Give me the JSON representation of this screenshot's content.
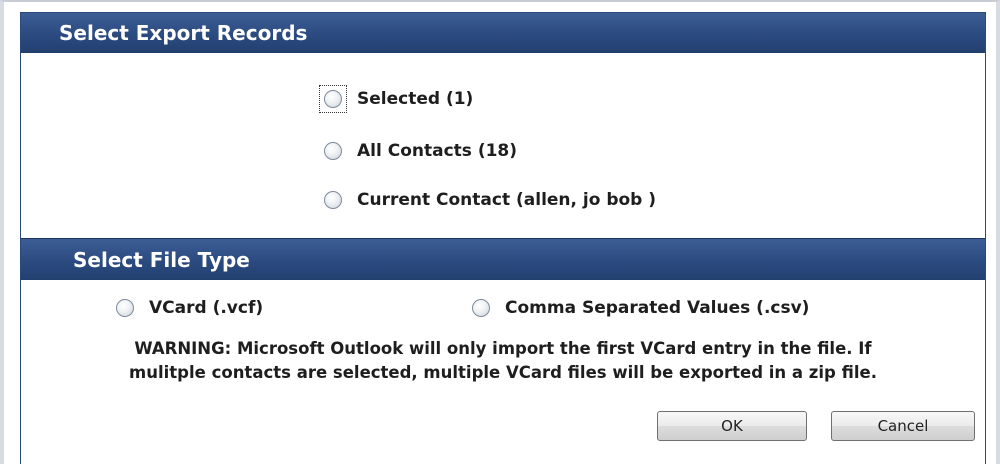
{
  "export_section": {
    "title": "Select Export Records",
    "options": [
      {
        "label": "Selected (1)",
        "checked": false,
        "focused": true
      },
      {
        "label": "All Contacts (18)",
        "checked": false
      },
      {
        "label": "Current Contact (allen, jo bob )",
        "checked": false
      }
    ]
  },
  "filetype_section": {
    "title": "Select File Type",
    "options": [
      {
        "label": "VCard (.vcf)",
        "checked": false
      },
      {
        "label": "Comma Separated Values (.csv)",
        "checked": false
      }
    ],
    "warning_line1": "WARNING: Microsoft Outlook will only import the first VCard entry in the file. If",
    "warning_line2": "mulitple contacts are selected, multiple VCard files will be exported in a zip file."
  },
  "buttons": {
    "ok_label": "OK",
    "cancel_label": "Cancel"
  },
  "colors": {
    "header_bg": "#2b4a80",
    "header_text": "#ffffff"
  }
}
